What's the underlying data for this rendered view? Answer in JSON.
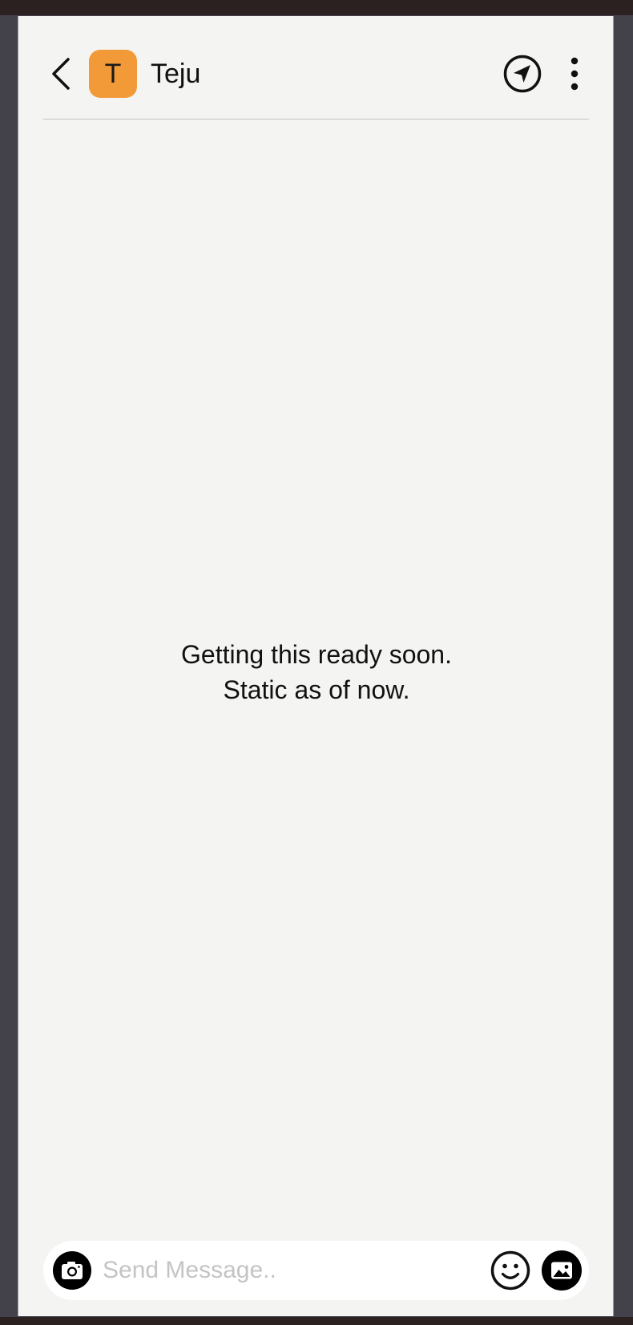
{
  "header": {
    "avatar_initial": "T",
    "contact_name": "Teju",
    "avatar_color": "#f39a38"
  },
  "body": {
    "message_line1": "Getting this ready soon.",
    "message_line2": "Static as of now."
  },
  "composer": {
    "placeholder": "Send Message..",
    "value": ""
  },
  "icons": {
    "back": "chevron-left-icon",
    "location": "navigation-arrow-icon",
    "menu": "more-vertical-icon",
    "camera": "camera-icon",
    "emoji": "smiley-icon",
    "gallery": "image-icon"
  }
}
